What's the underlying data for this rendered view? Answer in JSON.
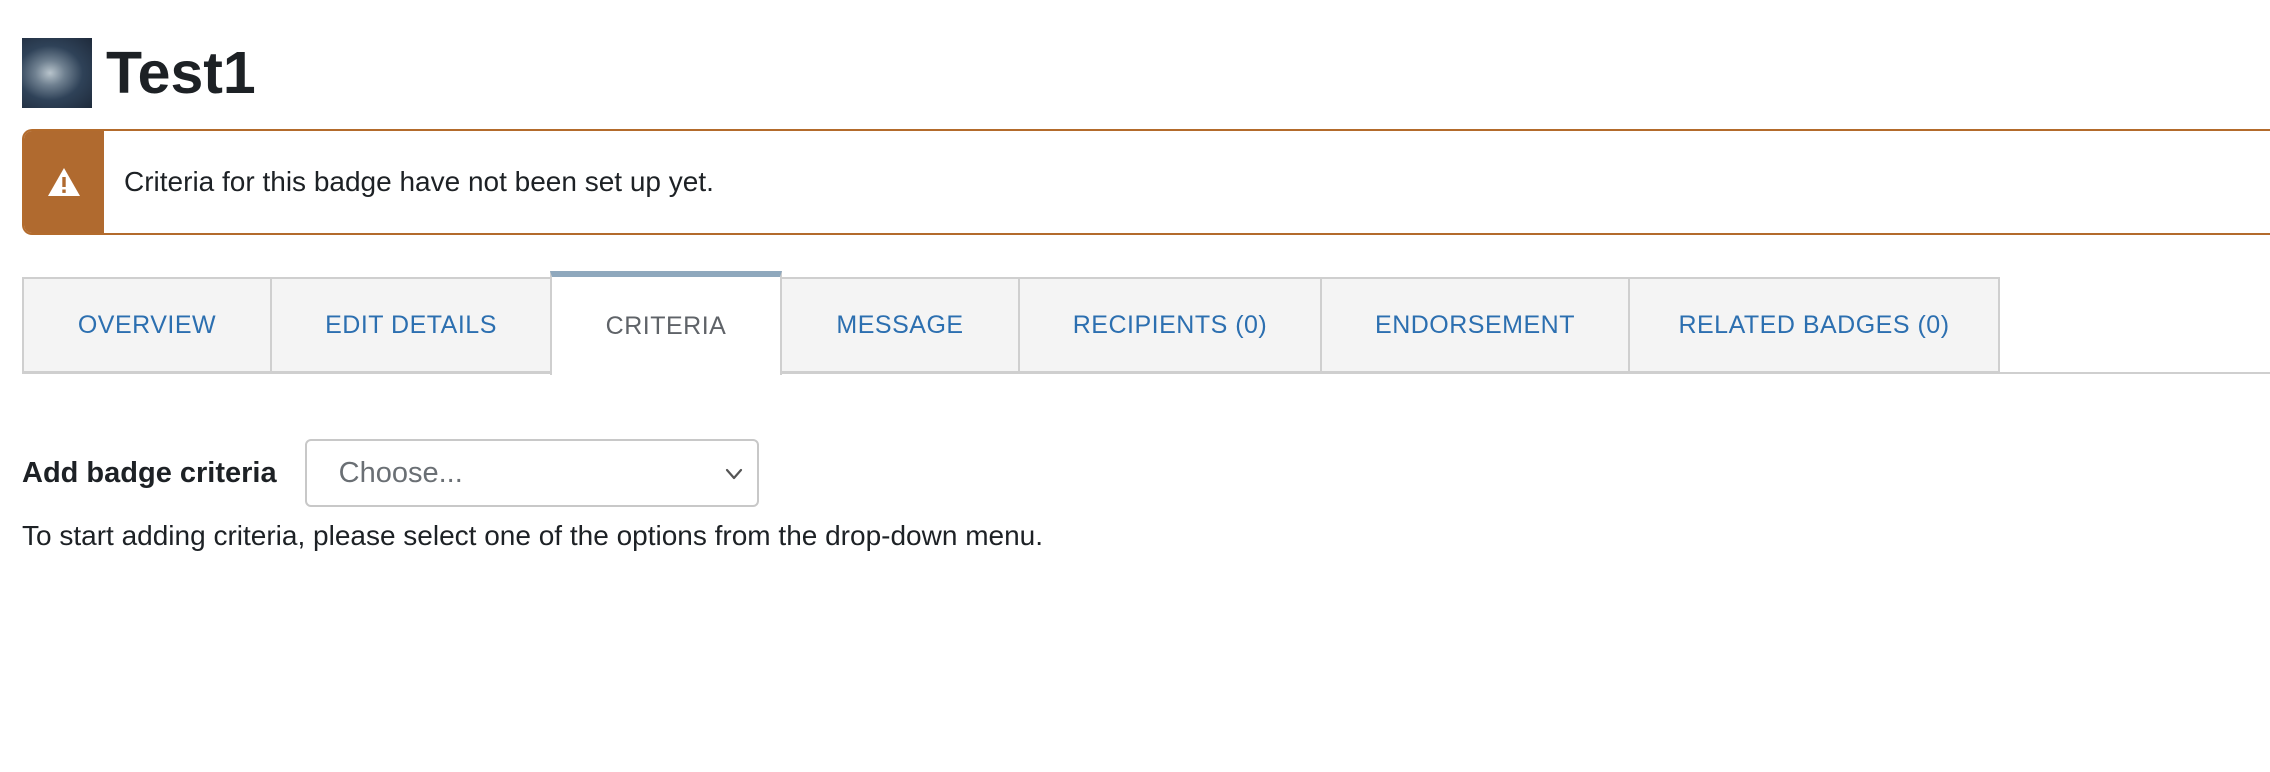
{
  "header": {
    "title": "Test1",
    "badge_image_icon": "badge-thumbnail"
  },
  "alert": {
    "icon": "warning-icon",
    "message": "Criteria for this badge have not been set up yet.",
    "accent_color": "#b06a2f"
  },
  "tabs": [
    {
      "label": "OVERVIEW",
      "active": false
    },
    {
      "label": "EDIT DETAILS",
      "active": false
    },
    {
      "label": "CRITERIA",
      "active": true
    },
    {
      "label": "MESSAGE",
      "active": false
    },
    {
      "label": "RECIPIENTS (0)",
      "active": false
    },
    {
      "label": "ENDORSEMENT",
      "active": false
    },
    {
      "label": "RELATED BADGES (0)",
      "active": false
    }
  ],
  "criteria": {
    "label": "Add badge criteria",
    "select_value": "Choose...",
    "help_text": "To start adding criteria, please select one of the options from the drop-down menu."
  },
  "colors": {
    "link": "#2c6fb0",
    "active_tab_border": "#8fa8bd"
  }
}
